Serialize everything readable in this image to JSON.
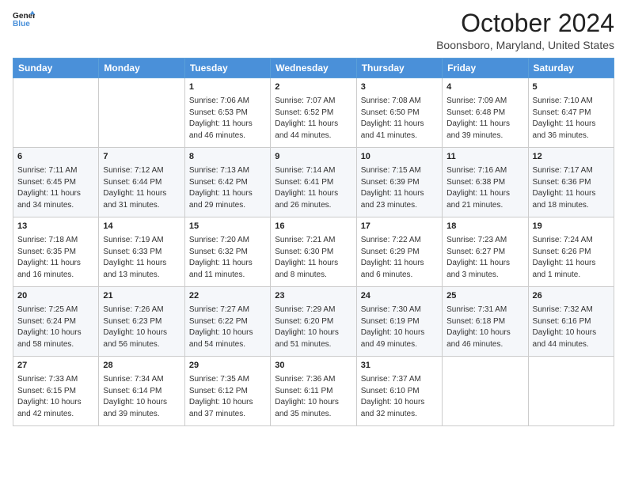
{
  "header": {
    "logo_line1": "General",
    "logo_line2": "Blue",
    "month": "October 2024",
    "location": "Boonsboro, Maryland, United States"
  },
  "days_of_week": [
    "Sunday",
    "Monday",
    "Tuesday",
    "Wednesday",
    "Thursday",
    "Friday",
    "Saturday"
  ],
  "weeks": [
    [
      {
        "day": "",
        "sunrise": "",
        "sunset": "",
        "daylight": ""
      },
      {
        "day": "",
        "sunrise": "",
        "sunset": "",
        "daylight": ""
      },
      {
        "day": "1",
        "sunrise": "Sunrise: 7:06 AM",
        "sunset": "Sunset: 6:53 PM",
        "daylight": "Daylight: 11 hours and 46 minutes."
      },
      {
        "day": "2",
        "sunrise": "Sunrise: 7:07 AM",
        "sunset": "Sunset: 6:52 PM",
        "daylight": "Daylight: 11 hours and 44 minutes."
      },
      {
        "day": "3",
        "sunrise": "Sunrise: 7:08 AM",
        "sunset": "Sunset: 6:50 PM",
        "daylight": "Daylight: 11 hours and 41 minutes."
      },
      {
        "day": "4",
        "sunrise": "Sunrise: 7:09 AM",
        "sunset": "Sunset: 6:48 PM",
        "daylight": "Daylight: 11 hours and 39 minutes."
      },
      {
        "day": "5",
        "sunrise": "Sunrise: 7:10 AM",
        "sunset": "Sunset: 6:47 PM",
        "daylight": "Daylight: 11 hours and 36 minutes."
      }
    ],
    [
      {
        "day": "6",
        "sunrise": "Sunrise: 7:11 AM",
        "sunset": "Sunset: 6:45 PM",
        "daylight": "Daylight: 11 hours and 34 minutes."
      },
      {
        "day": "7",
        "sunrise": "Sunrise: 7:12 AM",
        "sunset": "Sunset: 6:44 PM",
        "daylight": "Daylight: 11 hours and 31 minutes."
      },
      {
        "day": "8",
        "sunrise": "Sunrise: 7:13 AM",
        "sunset": "Sunset: 6:42 PM",
        "daylight": "Daylight: 11 hours and 29 minutes."
      },
      {
        "day": "9",
        "sunrise": "Sunrise: 7:14 AM",
        "sunset": "Sunset: 6:41 PM",
        "daylight": "Daylight: 11 hours and 26 minutes."
      },
      {
        "day": "10",
        "sunrise": "Sunrise: 7:15 AM",
        "sunset": "Sunset: 6:39 PM",
        "daylight": "Daylight: 11 hours and 23 minutes."
      },
      {
        "day": "11",
        "sunrise": "Sunrise: 7:16 AM",
        "sunset": "Sunset: 6:38 PM",
        "daylight": "Daylight: 11 hours and 21 minutes."
      },
      {
        "day": "12",
        "sunrise": "Sunrise: 7:17 AM",
        "sunset": "Sunset: 6:36 PM",
        "daylight": "Daylight: 11 hours and 18 minutes."
      }
    ],
    [
      {
        "day": "13",
        "sunrise": "Sunrise: 7:18 AM",
        "sunset": "Sunset: 6:35 PM",
        "daylight": "Daylight: 11 hours and 16 minutes."
      },
      {
        "day": "14",
        "sunrise": "Sunrise: 7:19 AM",
        "sunset": "Sunset: 6:33 PM",
        "daylight": "Daylight: 11 hours and 13 minutes."
      },
      {
        "day": "15",
        "sunrise": "Sunrise: 7:20 AM",
        "sunset": "Sunset: 6:32 PM",
        "daylight": "Daylight: 11 hours and 11 minutes."
      },
      {
        "day": "16",
        "sunrise": "Sunrise: 7:21 AM",
        "sunset": "Sunset: 6:30 PM",
        "daylight": "Daylight: 11 hours and 8 minutes."
      },
      {
        "day": "17",
        "sunrise": "Sunrise: 7:22 AM",
        "sunset": "Sunset: 6:29 PM",
        "daylight": "Daylight: 11 hours and 6 minutes."
      },
      {
        "day": "18",
        "sunrise": "Sunrise: 7:23 AM",
        "sunset": "Sunset: 6:27 PM",
        "daylight": "Daylight: 11 hours and 3 minutes."
      },
      {
        "day": "19",
        "sunrise": "Sunrise: 7:24 AM",
        "sunset": "Sunset: 6:26 PM",
        "daylight": "Daylight: 11 hours and 1 minute."
      }
    ],
    [
      {
        "day": "20",
        "sunrise": "Sunrise: 7:25 AM",
        "sunset": "Sunset: 6:24 PM",
        "daylight": "Daylight: 10 hours and 58 minutes."
      },
      {
        "day": "21",
        "sunrise": "Sunrise: 7:26 AM",
        "sunset": "Sunset: 6:23 PM",
        "daylight": "Daylight: 10 hours and 56 minutes."
      },
      {
        "day": "22",
        "sunrise": "Sunrise: 7:27 AM",
        "sunset": "Sunset: 6:22 PM",
        "daylight": "Daylight: 10 hours and 54 minutes."
      },
      {
        "day": "23",
        "sunrise": "Sunrise: 7:29 AM",
        "sunset": "Sunset: 6:20 PM",
        "daylight": "Daylight: 10 hours and 51 minutes."
      },
      {
        "day": "24",
        "sunrise": "Sunrise: 7:30 AM",
        "sunset": "Sunset: 6:19 PM",
        "daylight": "Daylight: 10 hours and 49 minutes."
      },
      {
        "day": "25",
        "sunrise": "Sunrise: 7:31 AM",
        "sunset": "Sunset: 6:18 PM",
        "daylight": "Daylight: 10 hours and 46 minutes."
      },
      {
        "day": "26",
        "sunrise": "Sunrise: 7:32 AM",
        "sunset": "Sunset: 6:16 PM",
        "daylight": "Daylight: 10 hours and 44 minutes."
      }
    ],
    [
      {
        "day": "27",
        "sunrise": "Sunrise: 7:33 AM",
        "sunset": "Sunset: 6:15 PM",
        "daylight": "Daylight: 10 hours and 42 minutes."
      },
      {
        "day": "28",
        "sunrise": "Sunrise: 7:34 AM",
        "sunset": "Sunset: 6:14 PM",
        "daylight": "Daylight: 10 hours and 39 minutes."
      },
      {
        "day": "29",
        "sunrise": "Sunrise: 7:35 AM",
        "sunset": "Sunset: 6:12 PM",
        "daylight": "Daylight: 10 hours and 37 minutes."
      },
      {
        "day": "30",
        "sunrise": "Sunrise: 7:36 AM",
        "sunset": "Sunset: 6:11 PM",
        "daylight": "Daylight: 10 hours and 35 minutes."
      },
      {
        "day": "31",
        "sunrise": "Sunrise: 7:37 AM",
        "sunset": "Sunset: 6:10 PM",
        "daylight": "Daylight: 10 hours and 32 minutes."
      },
      {
        "day": "",
        "sunrise": "",
        "sunset": "",
        "daylight": ""
      },
      {
        "day": "",
        "sunrise": "",
        "sunset": "",
        "daylight": ""
      }
    ]
  ]
}
